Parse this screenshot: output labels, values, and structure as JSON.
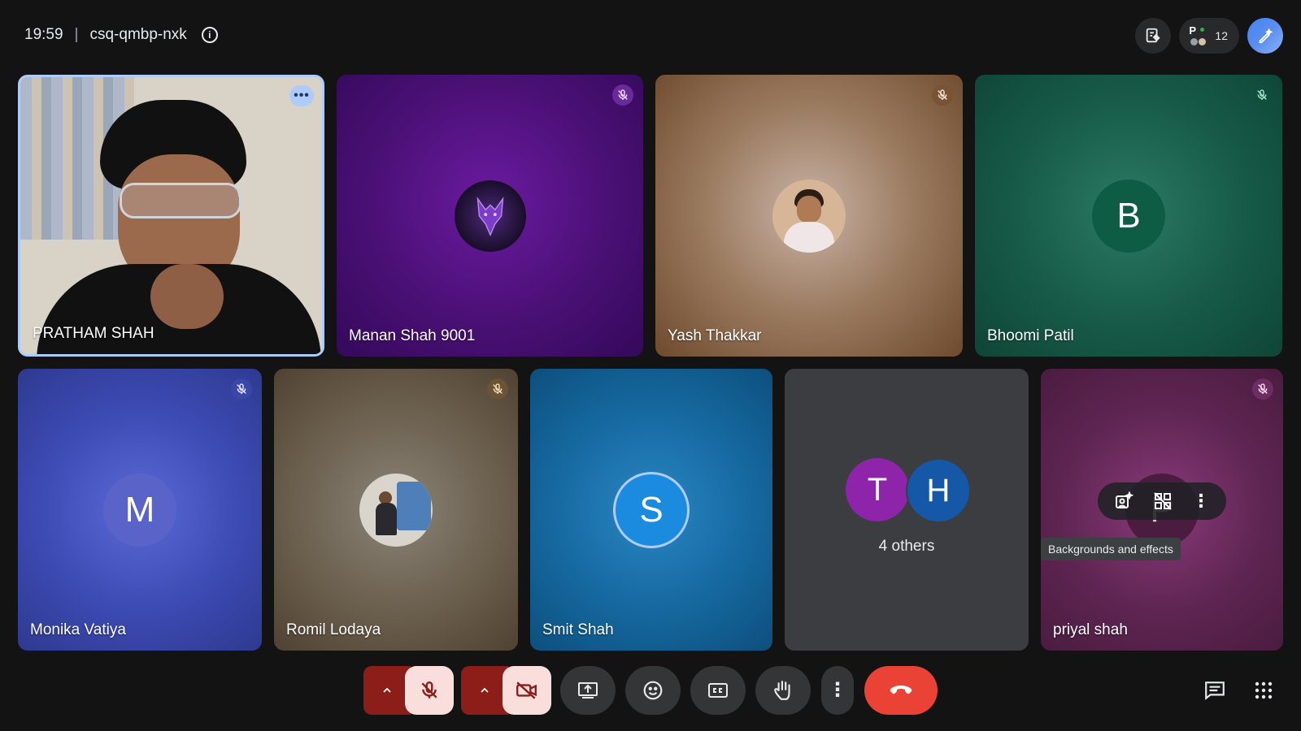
{
  "meeting": {
    "time": "19:59",
    "separator": "|",
    "code": "csq-qmbp-nxk"
  },
  "top_right": {
    "participant_initial": "P",
    "participant_count": "12"
  },
  "tiles": [
    {
      "name": "PRATHAM SHAH",
      "type": "video"
    },
    {
      "name": "Manan Shah 9001",
      "type": "avatar-image",
      "muted": true
    },
    {
      "name": "Yash Thakkar",
      "type": "avatar-image",
      "muted": true
    },
    {
      "name": "Bhoomi Patil",
      "type": "initial",
      "initial": "B",
      "muted": true
    },
    {
      "name": "Monika Vatiya",
      "type": "initial",
      "initial": "M",
      "muted": true
    },
    {
      "name": "Romil Lodaya",
      "type": "avatar-image",
      "muted": true
    },
    {
      "name": "Smit Shah",
      "type": "initial",
      "initial": "S"
    },
    {
      "name": "4 others",
      "type": "others",
      "initials": [
        "T",
        "H"
      ]
    },
    {
      "name": "priyal shah",
      "type": "initial",
      "initial": "P",
      "muted": true
    }
  ],
  "tooltip": "Backgrounds and effects",
  "colors": {
    "background": "#131314",
    "end_call": "#ea4335",
    "mic_off_bg": "#f9dedc",
    "chevron_bg": "#8c1d18",
    "accent_blue": "#8ab4f8"
  }
}
